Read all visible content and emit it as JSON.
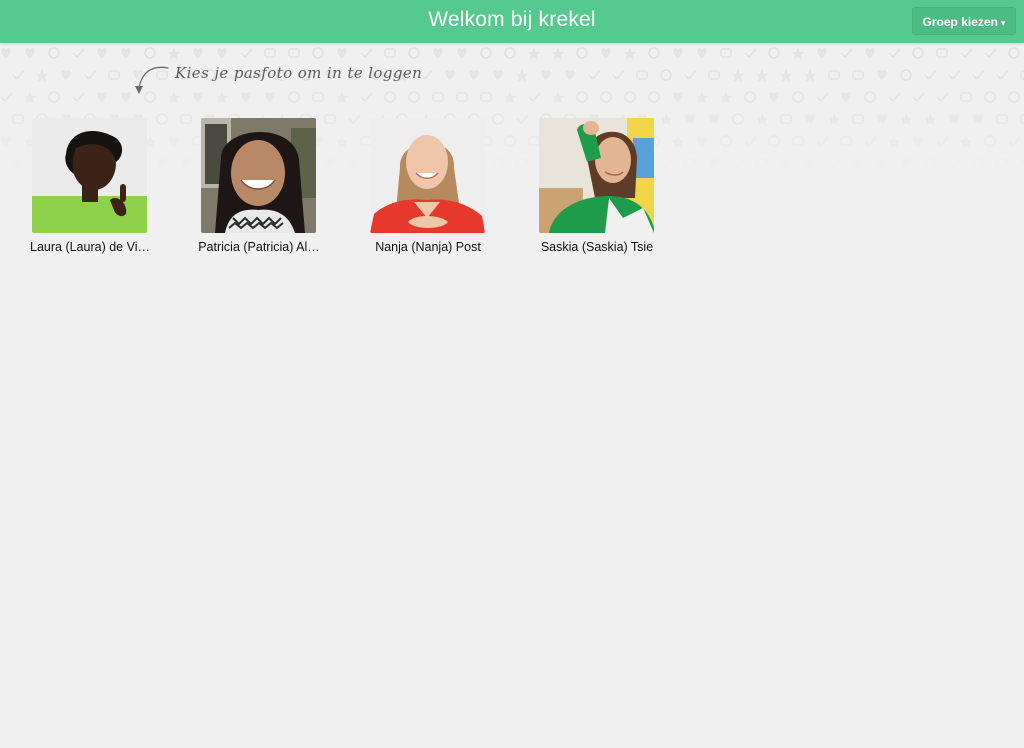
{
  "header": {
    "title": "Welkom bij krekel",
    "group_button_label": "Groep kiezen",
    "group_button_caret": "▾",
    "accent_color": "#55c98f"
  },
  "hint": {
    "text": "Kies je pasfoto om in te loggen"
  },
  "users": [
    {
      "name": "Laura (Laura) de Vi…",
      "avatar": "photo-laura"
    },
    {
      "name": "Patricia (Patricia) Al…",
      "avatar": "photo-patricia"
    },
    {
      "name": "Nanja (Nanja) Post",
      "avatar": "photo-nanja"
    },
    {
      "name": "Saskia (Saskia) Tsie",
      "avatar": "photo-saskia"
    }
  ]
}
